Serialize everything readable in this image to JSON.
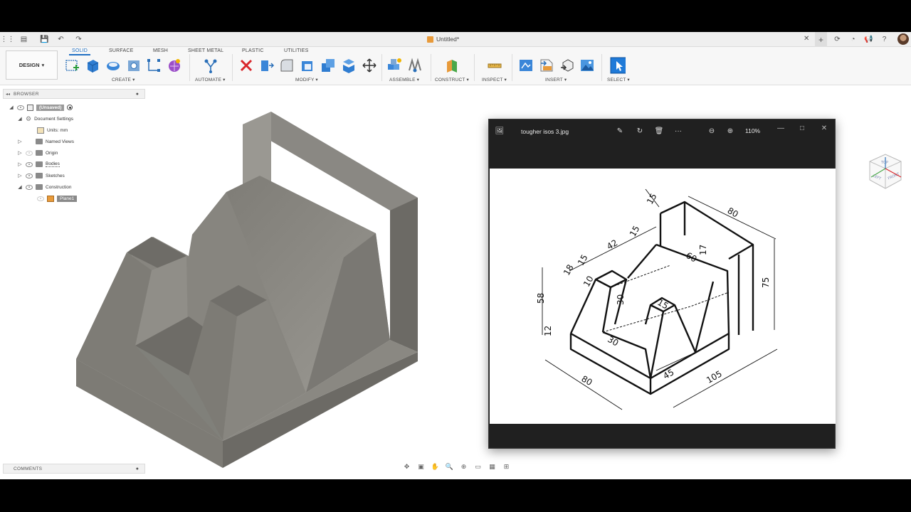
{
  "window": {
    "doc_title": "Untitled*"
  },
  "ribbon": {
    "design_label": "DESIGN",
    "tabs": [
      "SOLID",
      "SURFACE",
      "MESH",
      "SHEET METAL",
      "PLASTIC",
      "UTILITIES"
    ],
    "active_tab": "SOLID",
    "groups": [
      "CREATE",
      "AUTOMATE",
      "MODIFY",
      "ASSEMBLE",
      "CONSTRUCT",
      "INSPECT",
      "INSERT",
      "SELECT"
    ]
  },
  "browser": {
    "title": "BROWSER",
    "root": "(Unsaved)",
    "document_settings": "Document Settings",
    "units": "Units: mm",
    "items": [
      "Named Views",
      "Origin",
      "Bodies",
      "Sketches",
      "Construction"
    ],
    "plane": "Plane1"
  },
  "comments": {
    "title": "COMMENTS"
  },
  "viewcube": {
    "top": "TOP",
    "left": "LEFT",
    "front": "FRONT"
  },
  "photo_viewer": {
    "file_name": "tougher isos 3.jpg",
    "zoom": "110%",
    "dims": [
      "15",
      "80",
      "42",
      "15",
      "18",
      "15",
      "10",
      "17",
      "60",
      "58",
      "30",
      "15",
      "75",
      "12",
      "30",
      "80",
      "45",
      "105"
    ]
  },
  "colors": {
    "accent": "#1f6fc3",
    "model_top": "#8c8a84",
    "model_front": "#7d7b75",
    "model_side": "#6c6a65"
  }
}
